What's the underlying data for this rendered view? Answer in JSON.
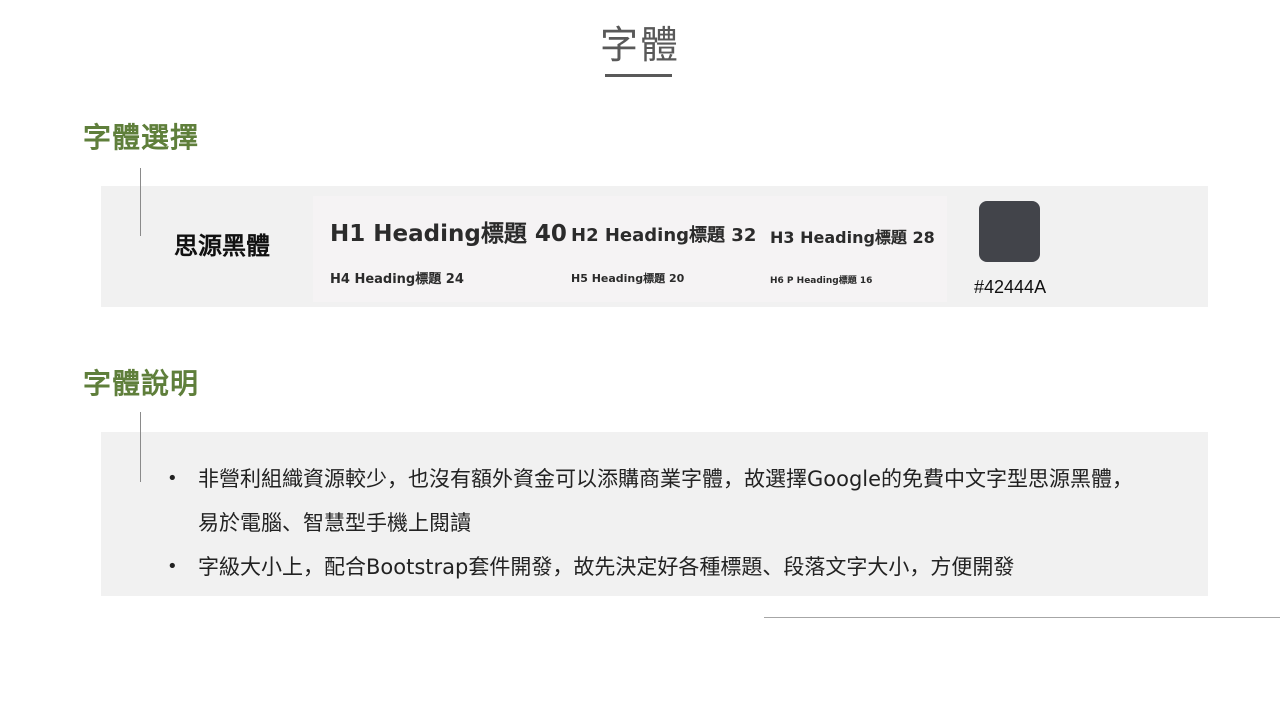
{
  "page": {
    "title": "字體"
  },
  "font_selection": {
    "heading": "字體選擇",
    "font_name": "思源黑體",
    "samples": [
      {
        "label": "H1 Heading標題 40",
        "size": 40
      },
      {
        "label": "H2 Heading標題 32",
        "size": 32
      },
      {
        "label": "H3 Heading標題 28",
        "size": 28
      },
      {
        "label": "H4 Heading標題 24",
        "size": 24
      },
      {
        "label": "H5 Heading標題 20",
        "size": 20
      },
      {
        "label": "H6 P Heading標題 16",
        "size": 16
      }
    ],
    "swatch": {
      "color": "#42444A",
      "label": "#42444A"
    }
  },
  "font_description": {
    "heading": "字體說明",
    "bullets": [
      "非營利組織資源較少，也沒有額外資金可以添購商業字體，故選擇Google的免費中文字型思源黑體，易於電腦、智慧型手機上閱讀",
      "字級大小上，配合Bootstrap套件開發，故先決定好各種標題、段落文字大小，方便開發"
    ]
  },
  "colors": {
    "heading_green": "#5f7f3b",
    "title_gray": "#595959",
    "panel_bg": "#f1f1f1"
  }
}
